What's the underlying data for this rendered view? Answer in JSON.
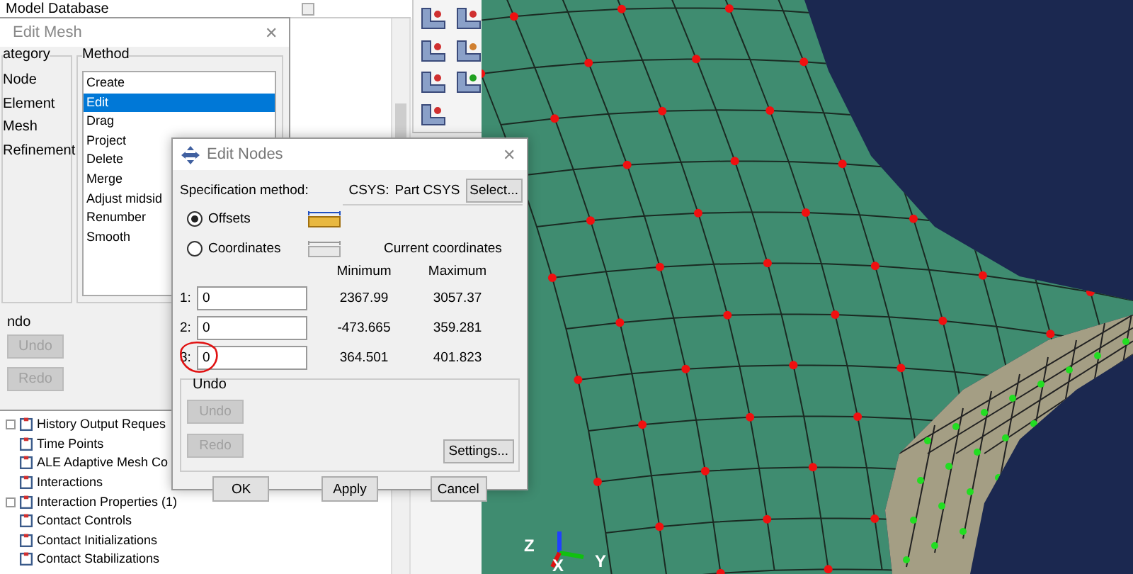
{
  "model_bar": {
    "title": "Model Database"
  },
  "model_tree": {
    "items": [
      {
        "label": "History Output Reques",
        "kind": "folder"
      },
      {
        "label": "Time Points",
        "kind": "leaf"
      },
      {
        "label": "ALE Adaptive Mesh Co",
        "kind": "leaf"
      },
      {
        "label": "Interactions",
        "kind": "leaf"
      },
      {
        "label": "Interaction Properties (1)",
        "kind": "folder"
      },
      {
        "label": "Contact Controls",
        "kind": "leaf"
      },
      {
        "label": "Contact Initializations",
        "kind": "leaf"
      },
      {
        "label": "Contact Stabilizations",
        "kind": "leaf"
      }
    ]
  },
  "edit_mesh": {
    "title": "Edit Mesh",
    "close_glyph": "✕",
    "category_label": "ategory",
    "categories": [
      "Node",
      "Element",
      "Mesh",
      "Refinement"
    ],
    "method_label": "Method",
    "methods": [
      {
        "label": "Create",
        "selected": false
      },
      {
        "label": "Edit",
        "selected": true
      },
      {
        "label": "Drag",
        "selected": false
      },
      {
        "label": "Project",
        "selected": false
      },
      {
        "label": "Delete",
        "selected": false
      },
      {
        "label": "Merge",
        "selected": false
      },
      {
        "label": "Adjust midsid",
        "selected": false
      },
      {
        "label": "Renumber",
        "selected": false
      },
      {
        "label": "Smooth",
        "selected": false
      }
    ],
    "undo_label": "ndo",
    "buttons": [
      {
        "label": "Undo",
        "disabled": true
      },
      {
        "label": "Redo",
        "disabled": true
      }
    ]
  },
  "edit_nodes": {
    "title": "Edit Nodes",
    "close_glyph": "✕",
    "spec_label": "Specification method:",
    "csys_label": "CSYS:",
    "csys_value": "Part CSYS",
    "select_button": "Select...",
    "methods": [
      {
        "label": "Offsets",
        "selected": true
      },
      {
        "label": "Coordinates",
        "selected": false
      }
    ],
    "coords_title": "Current coordinates",
    "min_header": "Minimum",
    "max_header": "Maximum",
    "rows": [
      {
        "index": "1:",
        "value": "0",
        "minimum": "2367.99",
        "maximum": "3057.37",
        "circled": false
      },
      {
        "index": "2:",
        "value": "0",
        "minimum": "-473.665",
        "maximum": "359.281",
        "circled": false
      },
      {
        "index": "3:",
        "value": "0",
        "minimum": "364.501",
        "maximum": "401.823",
        "circled": true
      }
    ],
    "undo_label": "Undo",
    "undo_buttons": [
      {
        "label": "Undo",
        "disabled": true
      },
      {
        "label": "Redo",
        "disabled": true
      }
    ],
    "settings_button": "Settings...",
    "footer_buttons": [
      "OK",
      "Apply",
      "Cancel"
    ]
  },
  "viewport": {
    "triad": [
      "Z",
      "X",
      "Y"
    ]
  }
}
